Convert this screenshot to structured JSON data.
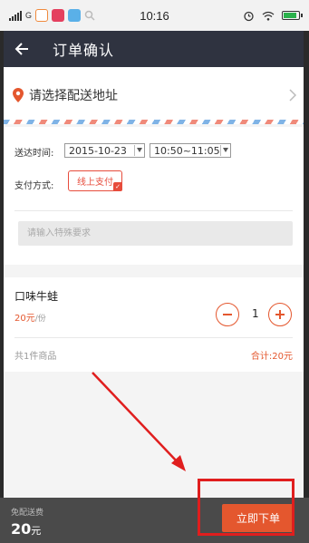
{
  "status_bar": {
    "network": "G",
    "time": "10:16"
  },
  "header": {
    "title": "订单确认"
  },
  "address": {
    "prompt": "请选择配送地址"
  },
  "delivery": {
    "label": "送达时间:",
    "date": "2015-10-23",
    "time_slot": "10:50~11:05"
  },
  "payment": {
    "label": "支付方式:",
    "method": "线上支付"
  },
  "remark": {
    "placeholder": "请输入特殊要求"
  },
  "item": {
    "name": "口味牛蛙",
    "price": "20元",
    "unit": "/份",
    "quantity": "1",
    "summary_count": "共1件商品",
    "summary_total": "合计:20元"
  },
  "bottom": {
    "delivery_fee": "免配送费",
    "total_amount": "20",
    "currency": "元",
    "submit_label": "立即下单"
  },
  "colors": {
    "accent": "#e4572e",
    "header_bg": "#2f3340",
    "annotation_red": "#e01e1e"
  }
}
